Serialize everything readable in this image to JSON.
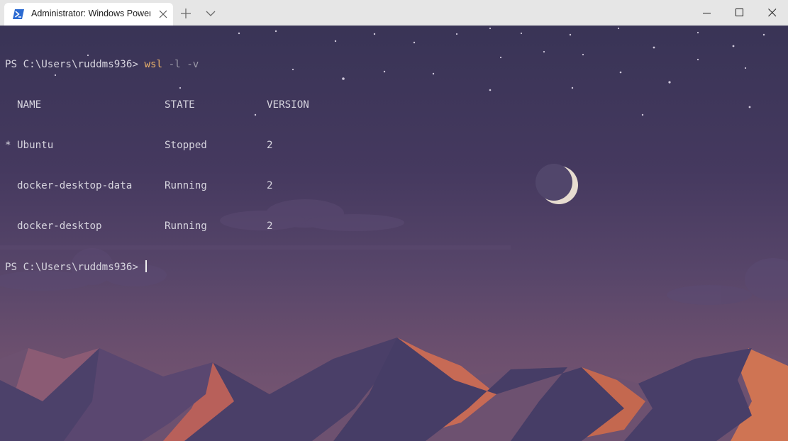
{
  "window": {
    "tab_title": "Administrator: Windows PowerShell",
    "tab_icon": "powershell-icon",
    "buttons": [
      "minimize-icon",
      "maximize-icon",
      "close-icon"
    ]
  },
  "terminal": {
    "prompt": "PS C:\\Users\\ruddms936>",
    "command": "wsl",
    "args": "-l -v",
    "headers": {
      "name": "NAME",
      "state": "STATE",
      "version": "VERSION"
    },
    "rows": [
      {
        "marker": "*",
        "name": "Ubuntu",
        "state": "Stopped",
        "version": "2"
      },
      {
        "marker": "",
        "name": "docker-desktop-data",
        "state": "Running",
        "version": "2"
      },
      {
        "marker": "",
        "name": "docker-desktop",
        "state": "Running",
        "version": "2"
      }
    ],
    "prompt2": "PS C:\\Users\\ruddms936>"
  },
  "colors": {
    "command": "#e8b06a",
    "text": "#d6d4de",
    "args": "#9c9aa8",
    "sky_top": "#393456",
    "dune_orange": "#c76a55"
  }
}
